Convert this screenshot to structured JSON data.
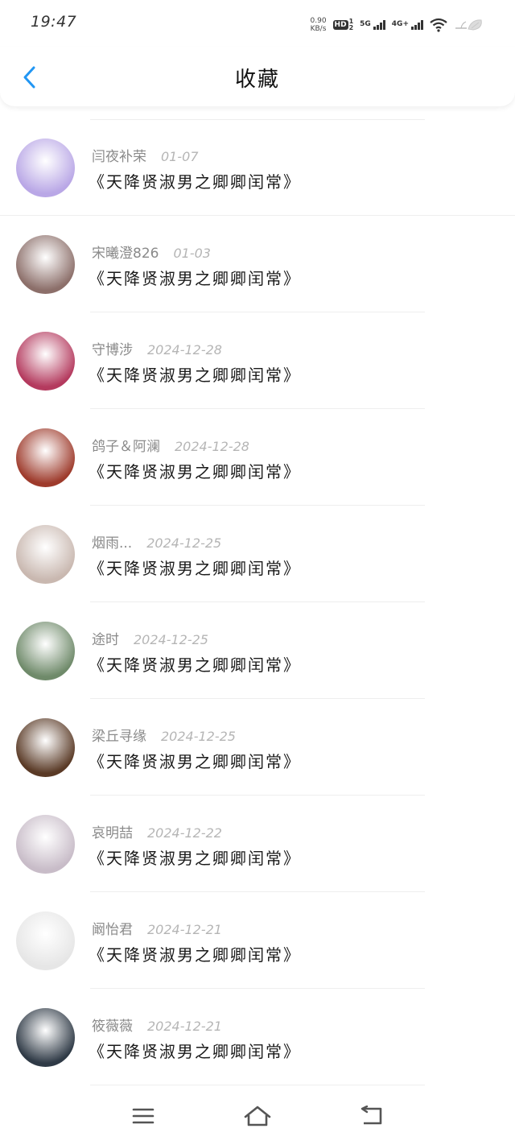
{
  "status": {
    "time": "19:47",
    "net_speed_value": "0.90",
    "net_speed_unit": "KB/s",
    "hd_label": "HD",
    "hd_sub_top": "1",
    "hd_sub_bottom": "2",
    "sig1_label": "5G",
    "sig2_label": "4G+"
  },
  "header": {
    "title": "收藏"
  },
  "items": [
    {
      "user": "闫夜补荣",
      "date": "01-07",
      "book": "《天降贤淑男之卿卿闰常》",
      "avatar_color": "#b9a7e6"
    },
    {
      "user": "宋曦澄826",
      "date": "01-03",
      "book": "《天降贤淑男之卿卿闰常》",
      "avatar_color": "#8c6f6a"
    },
    {
      "user": "守博涉",
      "date": "2024-12-28",
      "book": "《天降贤淑男之卿卿闰常》",
      "avatar_color": "#b43a5e"
    },
    {
      "user": "鸽子＆阿澜",
      "date": "2024-12-28",
      "book": "《天降贤淑男之卿卿闰常》",
      "avatar_color": "#9e3b2c"
    },
    {
      "user": "烟雨...",
      "date": "2024-12-25",
      "book": "《天降贤淑男之卿卿闰常》",
      "avatar_color": "#c9b8b0"
    },
    {
      "user": "途时",
      "date": "2024-12-25",
      "book": "《天降贤淑男之卿卿闰常》",
      "avatar_color": "#6f8a6a"
    },
    {
      "user": "梁丘寻缘",
      "date": "2024-12-25",
      "book": "《天降贤淑男之卿卿闰常》",
      "avatar_color": "#5a3a26"
    },
    {
      "user": "哀明喆",
      "date": "2024-12-22",
      "book": "《天降贤淑男之卿卿闰常》",
      "avatar_color": "#c8bcc8"
    },
    {
      "user": "阚怡君",
      "date": "2024-12-21",
      "book": "《天降贤淑男之卿卿闰常》",
      "avatar_color": "#e6e6e6"
    },
    {
      "user": "筱薇薇",
      "date": "2024-12-21",
      "book": "《天降贤淑男之卿卿闰常》",
      "avatar_color": "#2f3a46"
    }
  ],
  "colors": {
    "accent": "#2196f3",
    "title": "#111111",
    "username": "#8a8a8a",
    "date": "#b5b5b5",
    "divider": "#eeeeee"
  }
}
